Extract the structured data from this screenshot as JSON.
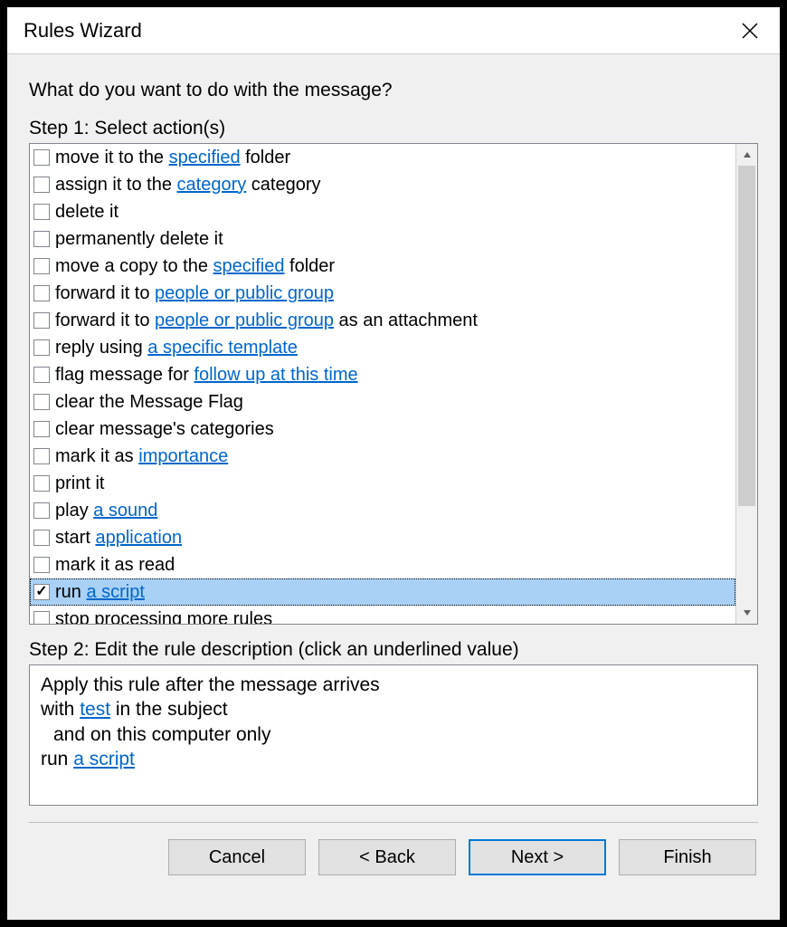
{
  "title": "Rules Wizard",
  "prompt": "What do you want to do with the message?",
  "step1_label": "Step 1: Select action(s)",
  "step2_label": "Step 2: Edit the rule description (click an underlined value)",
  "actions": [
    {
      "checked": false,
      "selected": false,
      "parts": [
        {
          "t": "move it to the "
        },
        {
          "t": "specified",
          "link": true
        },
        {
          "t": " folder"
        }
      ]
    },
    {
      "checked": false,
      "selected": false,
      "parts": [
        {
          "t": "assign it to the "
        },
        {
          "t": "category",
          "link": true
        },
        {
          "t": " category"
        }
      ]
    },
    {
      "checked": false,
      "selected": false,
      "parts": [
        {
          "t": "delete it"
        }
      ]
    },
    {
      "checked": false,
      "selected": false,
      "parts": [
        {
          "t": "permanently delete it"
        }
      ]
    },
    {
      "checked": false,
      "selected": false,
      "parts": [
        {
          "t": "move a copy to the "
        },
        {
          "t": "specified",
          "link": true
        },
        {
          "t": " folder"
        }
      ]
    },
    {
      "checked": false,
      "selected": false,
      "parts": [
        {
          "t": "forward it to "
        },
        {
          "t": "people or public group",
          "link": true
        }
      ]
    },
    {
      "checked": false,
      "selected": false,
      "parts": [
        {
          "t": "forward it to "
        },
        {
          "t": "people or public group",
          "link": true
        },
        {
          "t": " as an attachment"
        }
      ]
    },
    {
      "checked": false,
      "selected": false,
      "parts": [
        {
          "t": "reply using "
        },
        {
          "t": "a specific template",
          "link": true
        }
      ]
    },
    {
      "checked": false,
      "selected": false,
      "parts": [
        {
          "t": "flag message for "
        },
        {
          "t": "follow up at this time",
          "link": true
        }
      ]
    },
    {
      "checked": false,
      "selected": false,
      "parts": [
        {
          "t": "clear the Message Flag"
        }
      ]
    },
    {
      "checked": false,
      "selected": false,
      "parts": [
        {
          "t": "clear message's categories"
        }
      ]
    },
    {
      "checked": false,
      "selected": false,
      "parts": [
        {
          "t": "mark it as "
        },
        {
          "t": "importance",
          "link": true
        }
      ]
    },
    {
      "checked": false,
      "selected": false,
      "parts": [
        {
          "t": "print it"
        }
      ]
    },
    {
      "checked": false,
      "selected": false,
      "parts": [
        {
          "t": "play "
        },
        {
          "t": "a sound",
          "link": true
        }
      ]
    },
    {
      "checked": false,
      "selected": false,
      "parts": [
        {
          "t": "start "
        },
        {
          "t": "application",
          "link": true
        }
      ]
    },
    {
      "checked": false,
      "selected": false,
      "parts": [
        {
          "t": "mark it as read"
        }
      ]
    },
    {
      "checked": true,
      "selected": true,
      "parts": [
        {
          "t": "run "
        },
        {
          "t": "a script",
          "link": true
        }
      ]
    },
    {
      "checked": false,
      "selected": false,
      "parts": [
        {
          "t": "stop processing more rules"
        }
      ]
    }
  ],
  "description": {
    "line1": "Apply this rule after the message arrives",
    "line2_pre": "with ",
    "line2_link": "test",
    "line2_post": " in the subject",
    "line3": "and on this computer only",
    "line4_pre": "run ",
    "line4_link": "a script"
  },
  "buttons": {
    "cancel": "Cancel",
    "back": "< Back",
    "next": "Next >",
    "finish": "Finish"
  }
}
